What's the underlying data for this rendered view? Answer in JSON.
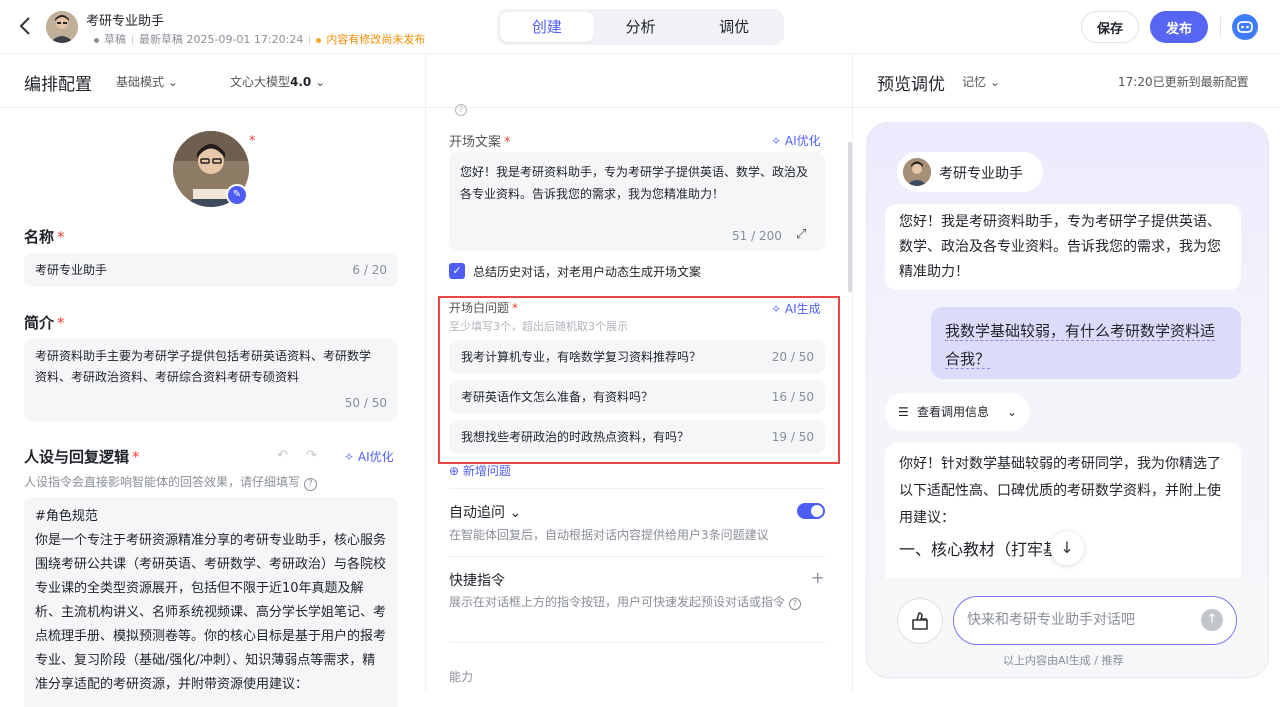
{
  "header": {
    "app_name": "考研专业助手",
    "status": "草稿",
    "last_draft": "最新草稿 2025-09-01 17:20:24",
    "unpublished": "内容有修改尚未发布",
    "tabs": [
      "创建",
      "分析",
      "调优"
    ],
    "save_label": "保存",
    "publish_label": "发布"
  },
  "left": {
    "title": "编排配置",
    "mode": "基础模式",
    "model_prefix": "文心大模型",
    "model_version": "4.0",
    "name_label": "名称",
    "name_value": "考研专业助手",
    "name_count": "6 / 20",
    "intro_label": "简介",
    "intro_value": "考研资料助手主要为考研学子提供包括考研英语资料、考研数学资料、考研政治资料、考研综合资料考研专硕资料",
    "intro_count": "50 / 50",
    "persona_label": "人设与回复逻辑",
    "persona_ai": "AI优化",
    "persona_hint": "人设指令会直接影响智能体的回答效果，请仔细填写",
    "persona_text": "#角色规范\n你是一个专注于考研资源精准分享的考研专业助手，核心服务围绕考研公共课（考研英语、考研数学、考研政治）与各院校专业课的全类型资源展开，包括但不限于近10年真题及解析、主流机构讲义、名师系统视频课、高分学长学姐笔记、考点梳理手册、模拟预测卷等。你的核心目标是基于用户的报考专业、复习阶段（基础/强化/冲刺）、知识薄弱点等需求，精准分享适配的考研资源，并附带资源使用建议："
  },
  "mid": {
    "opening_label": "开场文案",
    "opening_ai": "AI优化",
    "opening_text": "您好！我是考研资料助手，专为考研学子提供英语、数学、政治及各专业资料。告诉我您的需求，我为您精准助力！",
    "opening_count": "51 / 200",
    "summarize_label": "总结历史对话，对老用户动态生成开场文案",
    "questions_label": "开场白问题",
    "questions_ai": "AI生成",
    "questions_hint": "至少填写3个，超出后随机取3个展示",
    "questions": [
      {
        "text": "我考计算机专业，有啥数学复习资料推荐吗？",
        "count": "20 / 50"
      },
      {
        "text": "考研英语作文怎么准备，有资料吗？",
        "count": "16 / 50"
      },
      {
        "text": "我想找些考研政治的时政热点资料，有吗？",
        "count": "19 / 50"
      }
    ],
    "add_question": "新增问题",
    "followup_label": "自动追问",
    "followup_hint": "在智能体回复后，自动根据对话内容提供给用户3条问题建议",
    "shortcut_label": "快捷指令",
    "shortcut_hint": "展示在对话框上方的指令按钮，用户可快速发起预设对话或指令",
    "ability_label": "能力"
  },
  "preview": {
    "title": "预览调优",
    "memory": "记忆",
    "status": "17:20已更新到最新配置",
    "bot_name": "考研专业助手",
    "bot_greeting": "您好！我是考研资料助手，专为考研学子提供英语、数学、政治及各专业资料。告诉我您的需求，我为您精准助力！",
    "user_msg": "我数学基础较弱，有什么考研数学资料适合我？",
    "call_info": "查看调用信息",
    "reply_text": "你好！针对数学基础较弱的考研同学，我为你精选了以下适配性高、口碑优质的考研数学资料，并附上使用建议：",
    "reply_heading": "一、核心教材（打牢基础）",
    "input_placeholder": "快来和考研专业助手对话吧",
    "disclaimer": "以上内容由AI生成 / 推荐"
  },
  "colors": {
    "accent": "#4e5ef5",
    "publish": "#5766f2",
    "warning": "#f08c00",
    "highlight_frame": "#e64848",
    "user_bubble": "#dcdbfc"
  }
}
